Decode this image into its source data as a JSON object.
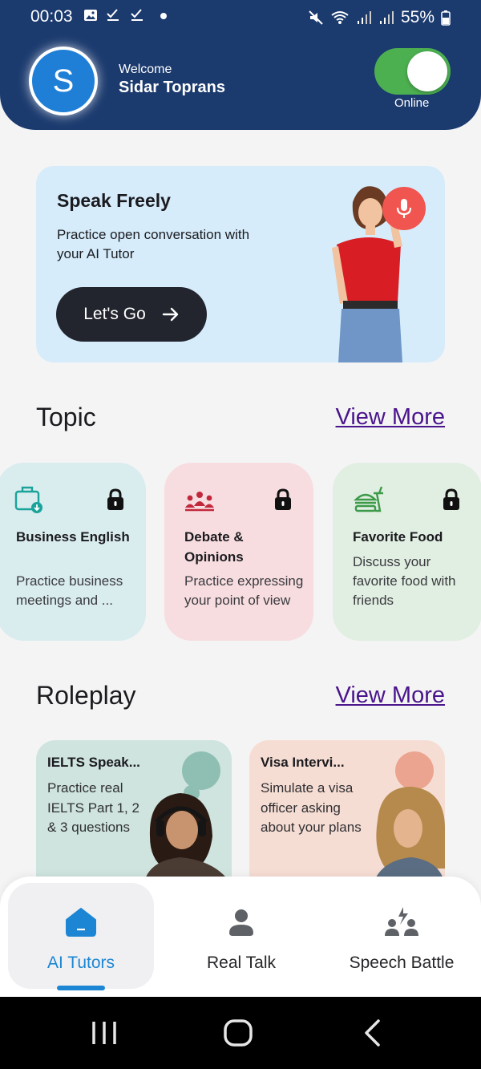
{
  "status_bar": {
    "time": "00:03",
    "battery": "55%"
  },
  "header": {
    "avatar_initial": "S",
    "welcome": "Welcome",
    "username": "Sidar Toprans",
    "online_label": "Online",
    "toggle_on": true
  },
  "hero": {
    "title": "Speak Freely",
    "description": "Practice open conversation with your AI Tutor",
    "button_label": "Let's Go"
  },
  "topic": {
    "title": "Topic",
    "view_more": "View More",
    "cards": [
      {
        "title": "Business English",
        "description": "Practice business meetings and ...",
        "icon": "briefcase-download-icon",
        "color": "#d9ecee",
        "accent": "#1aa39a"
      },
      {
        "title": "Debate & Opinions",
        "description": "Practice expressing your point of view",
        "icon": "group-discussion-icon",
        "color": "#f7dde0",
        "accent": "#c2283c"
      },
      {
        "title": "Favorite Food",
        "description": "Discuss your favorite food with friends",
        "icon": "burger-drink-icon",
        "color": "#e1eee2",
        "accent": "#3c9a48"
      }
    ]
  },
  "roleplay": {
    "title": "Roleplay",
    "view_more": "View More",
    "cards": [
      {
        "title": "IELTS Speak...",
        "description": "Practice real IELTS Part 1, 2 & 3 questions",
        "color": "#cfe4de"
      },
      {
        "title": "Visa Intervi...",
        "description": "Simulate a visa officer asking about your plans",
        "color": "#f6ddd3"
      }
    ]
  },
  "bottom_nav": {
    "items": [
      {
        "label": "AI Tutors",
        "icon": "home-icon",
        "active": true
      },
      {
        "label": "Real Talk",
        "icon": "person-icon",
        "active": false
      },
      {
        "label": "Speech Battle",
        "icon": "people-lightning-icon",
        "active": false
      }
    ]
  },
  "colors": {
    "header_bg": "#1b3a6e",
    "accent_blue": "#1c86d4",
    "link_purple": "#4a148c",
    "toggle_green": "#4caf50"
  }
}
